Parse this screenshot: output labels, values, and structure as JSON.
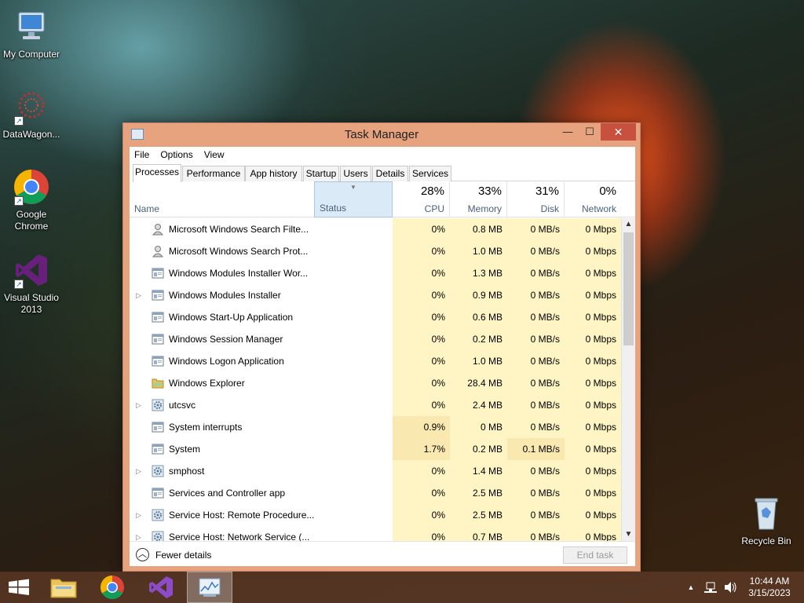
{
  "desktop": {
    "icons": [
      {
        "label": "My Computer"
      },
      {
        "label": "DataWagon..."
      },
      {
        "label": "Google Chrome"
      },
      {
        "label": "Visual Studio 2013"
      },
      {
        "label": "Recycle Bin"
      }
    ]
  },
  "window": {
    "title": "Task Manager",
    "menu": [
      "File",
      "Options",
      "View"
    ],
    "tabs": [
      "Processes",
      "Performance",
      "App history",
      "Startup",
      "Users",
      "Details",
      "Services"
    ],
    "active_tab": "Processes",
    "columns": {
      "name": "Name",
      "status": "Status",
      "cpu": {
        "label": "CPU",
        "percent": "28%"
      },
      "memory": {
        "label": "Memory",
        "percent": "33%"
      },
      "disk": {
        "label": "Disk",
        "percent": "31%"
      },
      "network": {
        "label": "Network",
        "percent": "0%"
      }
    },
    "processes": [
      {
        "name": "Microsoft Windows Search Filte...",
        "icon": "search-filter-icon",
        "expandable": false,
        "cpu": "0%",
        "memory": "0.8 MB",
        "disk": "0 MB/s",
        "network": "0 Mbps"
      },
      {
        "name": "Microsoft Windows Search Prot...",
        "icon": "search-protocol-icon",
        "expandable": false,
        "cpu": "0%",
        "memory": "1.0 MB",
        "disk": "0 MB/s",
        "network": "0 Mbps"
      },
      {
        "name": "Windows Modules Installer Wor...",
        "icon": "window-process-icon",
        "expandable": false,
        "cpu": "0%",
        "memory": "1.3 MB",
        "disk": "0 MB/s",
        "network": "0 Mbps"
      },
      {
        "name": "Windows Modules Installer",
        "icon": "window-process-icon",
        "expandable": true,
        "cpu": "0%",
        "memory": "0.9 MB",
        "disk": "0 MB/s",
        "network": "0 Mbps"
      },
      {
        "name": "Windows Start-Up Application",
        "icon": "window-process-icon",
        "expandable": false,
        "cpu": "0%",
        "memory": "0.6 MB",
        "disk": "0 MB/s",
        "network": "0 Mbps"
      },
      {
        "name": "Windows Session Manager",
        "icon": "window-process-icon",
        "expandable": false,
        "cpu": "0%",
        "memory": "0.2 MB",
        "disk": "0 MB/s",
        "network": "0 Mbps"
      },
      {
        "name": "Windows Logon Application",
        "icon": "window-process-icon",
        "expandable": false,
        "cpu": "0%",
        "memory": "1.0 MB",
        "disk": "0 MB/s",
        "network": "0 Mbps"
      },
      {
        "name": "Windows Explorer",
        "icon": "folder-icon",
        "expandable": false,
        "cpu": "0%",
        "memory": "28.4 MB",
        "disk": "0 MB/s",
        "network": "0 Mbps"
      },
      {
        "name": "utcsvc",
        "icon": "service-gear-icon",
        "expandable": true,
        "cpu": "0%",
        "memory": "2.4 MB",
        "disk": "0 MB/s",
        "network": "0 Mbps"
      },
      {
        "name": "System interrupts",
        "icon": "window-process-icon",
        "expandable": false,
        "cpu": "0.9%",
        "memory": "0 MB",
        "disk": "0 MB/s",
        "network": "0 Mbps"
      },
      {
        "name": "System",
        "icon": "window-process-icon",
        "expandable": false,
        "cpu": "1.7%",
        "memory": "0.2 MB",
        "disk": "0.1 MB/s",
        "network": "0 Mbps"
      },
      {
        "name": "smphost",
        "icon": "service-gear-icon",
        "expandable": true,
        "cpu": "0%",
        "memory": "1.4 MB",
        "disk": "0 MB/s",
        "network": "0 Mbps"
      },
      {
        "name": "Services and Controller app",
        "icon": "window-process-icon",
        "expandable": false,
        "cpu": "0%",
        "memory": "2.5 MB",
        "disk": "0 MB/s",
        "network": "0 Mbps"
      },
      {
        "name": "Service Host: Remote Procedure...",
        "icon": "service-gear-icon",
        "expandable": true,
        "cpu": "0%",
        "memory": "2.5 MB",
        "disk": "0 MB/s",
        "network": "0 Mbps"
      },
      {
        "name": "Service Host: Network Service (...",
        "icon": "service-gear-icon",
        "expandable": true,
        "cpu": "0%",
        "memory": "0.7 MB",
        "disk": "0 MB/s",
        "network": "0 Mbps"
      }
    ],
    "footer": {
      "fewer_details": "Fewer details",
      "end_task": "End task"
    }
  },
  "taskbar": {
    "clock_time": "10:44 AM",
    "clock_date": "3/15/2023"
  },
  "colors": {
    "window_frame": "#e7a27e",
    "close_button": "#c7503e",
    "heat_low": "#fff4c4",
    "heat_mid": "#f9e9b0",
    "status_header": "#daeaf7"
  }
}
